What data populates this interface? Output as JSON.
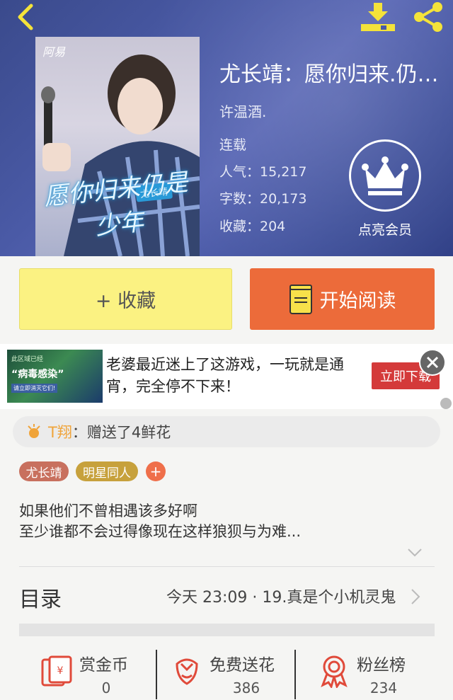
{
  "header": {
    "cover_logo": "阿易",
    "cover_title": "愿你归来仍是少年",
    "cover_badge": "尤长靖",
    "title": "尤长靖：愿你归来.仍是少年",
    "author": "许温酒.",
    "status": "连载",
    "stats": {
      "popularity": "人气：15,217",
      "words": "字数：20,173",
      "favorites": "收藏：204"
    },
    "vip_label": "点亮会员"
  },
  "actions": {
    "favorite_label": "+ 收藏",
    "read_label": "开始阅读"
  },
  "ad": {
    "img_line1": "此区域已经",
    "img_line2": "“病毒感染”",
    "img_line3": "请立即消灭它们!",
    "text": "老婆最近迷上了这游戏，一玩就是通宵，完全停不下来！",
    "cta": "立即下载"
  },
  "gift": {
    "user": "T翔",
    "message": "：赠送了4鲜花"
  },
  "tags": [
    "尤长靖",
    "明星同人"
  ],
  "tag_add": "+",
  "description": {
    "line1": "如果他们不曾相遇该多好啊",
    "line2": "至少谁都不会过得像现在这样狼狈与为难..."
  },
  "toc": {
    "label": "目录",
    "latest": "今天 23:09 · 19.真是个小机灵鬼"
  },
  "bottom_stats": [
    {
      "label": "赏金币",
      "value": "0"
    },
    {
      "label": "免费送花",
      "value": "386"
    },
    {
      "label": "粉丝榜",
      "value": "234"
    }
  ],
  "colors": {
    "accent_yellow": "#fbf282",
    "accent_orange": "#ec6b3a",
    "tag_red": "#c8705e",
    "tag_gold": "#c7a13c",
    "icon_red": "#e04a3a"
  }
}
